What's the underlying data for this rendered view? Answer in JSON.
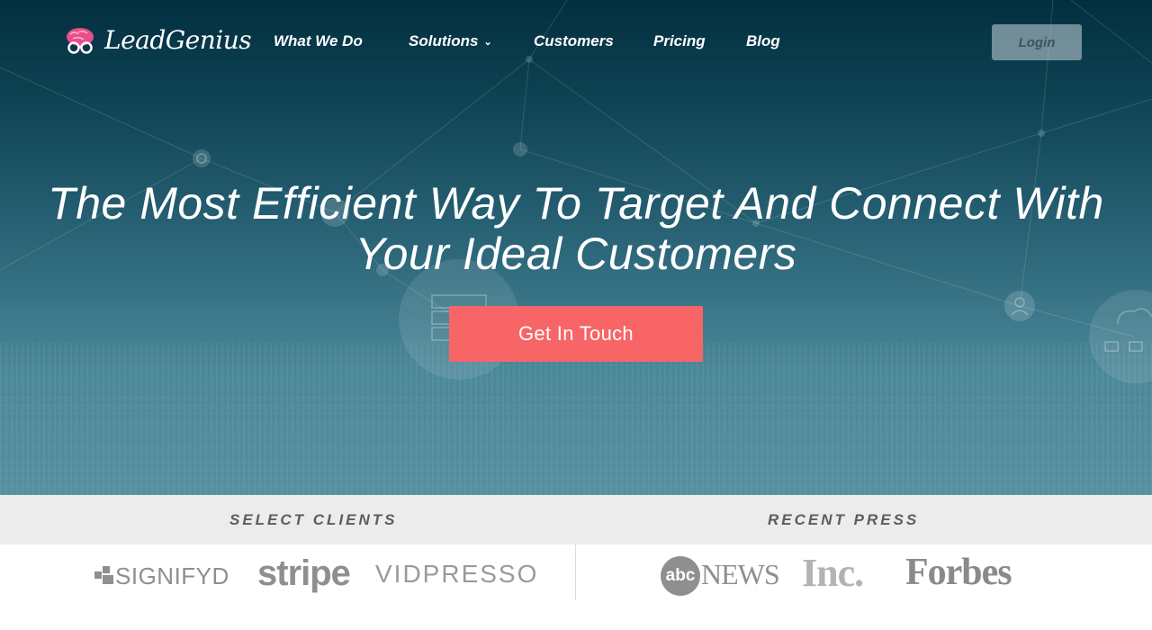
{
  "brand": {
    "name": "LeadGenius",
    "logo_icon": "brain-glasses-icon",
    "logo_color": "#e94e8a"
  },
  "nav": {
    "items": [
      {
        "label": "What We Do"
      },
      {
        "label": "Solutions",
        "has_dropdown": true
      },
      {
        "label": "Customers"
      },
      {
        "label": "Pricing"
      },
      {
        "label": "Blog"
      }
    ],
    "login_label": "Login"
  },
  "hero": {
    "headline_line1": "The Most Efficient Way To Target And Connect With",
    "headline_line2": "Your Ideal Customers",
    "cta_label": "Get In Touch",
    "cta_color": "#f76567"
  },
  "clients": {
    "heading": "SELECT CLIENTS",
    "logos": [
      "SIGNIFYD",
      "stripe",
      "VIDPRESSO"
    ]
  },
  "press": {
    "heading": "RECENT PRESS",
    "logos": [
      "abc",
      "NEWS",
      "Inc.",
      "Forbes"
    ]
  }
}
